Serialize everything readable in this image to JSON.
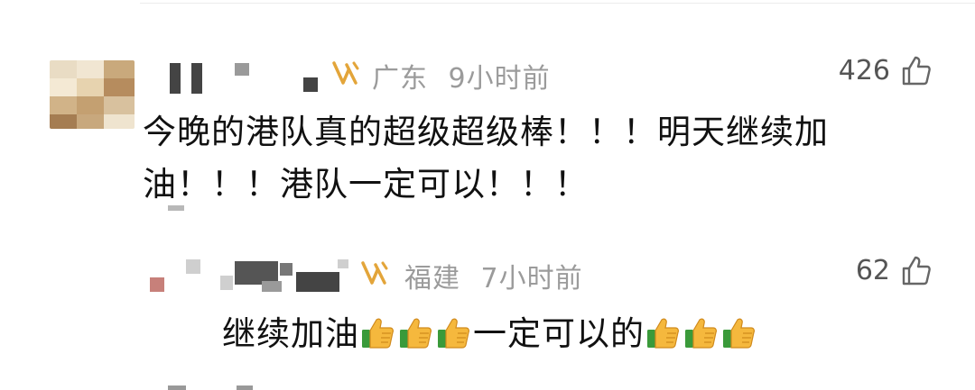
{
  "comments": [
    {
      "region": "广东",
      "time": "9小时前",
      "likes": "426",
      "text_line1": "今晚的港队真的超级超级棒！！！明天继续加",
      "text_line2": "油！！！港队一定可以！！！"
    }
  ],
  "reply": {
    "region": "福建",
    "time": "7小时前",
    "likes": "62",
    "text_part1": "继续加油",
    "text_part2": "一定可以的",
    "thumb_count_1": 3,
    "thumb_count_2": 3
  },
  "icons": {
    "vip": "vip-badge-icon",
    "like": "thumbs-up-outline-icon",
    "emoji": "thumbs-up-emoji-icon"
  },
  "colors": {
    "vip_gold": "#e3a53a",
    "meta_gray": "#9b9b9b",
    "emoji_yellow": "#f5b83d",
    "emoji_green": "#3a9a3a"
  }
}
